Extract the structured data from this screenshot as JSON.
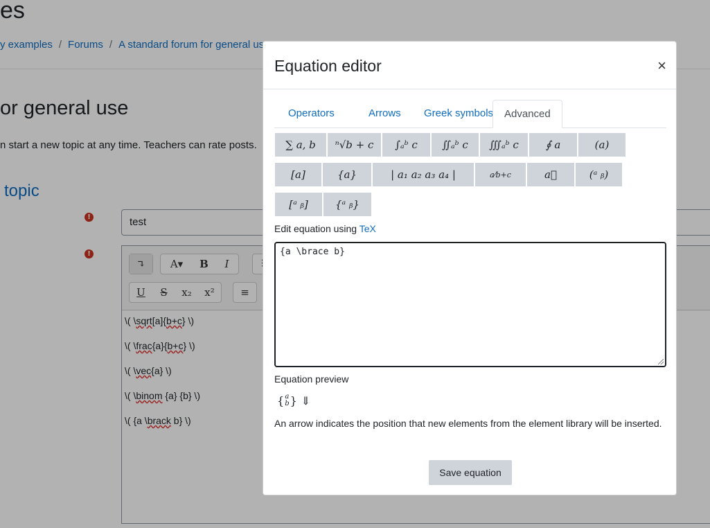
{
  "background": {
    "page_heading": "es",
    "breadcrumb": [
      "y examples",
      "Forums",
      "A standard forum for general use"
    ],
    "forum_title": "or general use",
    "forum_description": "n start a new topic at any time. Teachers can rate posts.",
    "section_title": "topic",
    "subject_value": "test",
    "editor_toolbar": {
      "row1": [
        "↴",
        "A▾",
        "B",
        "I",
        "⠿"
      ],
      "row2": [
        "U",
        "S",
        "x₂",
        "x²",
        "≡"
      ]
    },
    "editor_lines": [
      {
        "pre": "\\( \\",
        "sp": "sqrt",
        "mid": "[a]{",
        "sp2": "b+c",
        "post": "} \\)"
      },
      {
        "pre": "\\( \\",
        "sp": "frac",
        "mid": "{a}{",
        "sp2": "b+c",
        "post": "} \\)"
      },
      {
        "pre": "\\( \\",
        "sp": "vec",
        "mid": "{a} \\)",
        "sp2": "",
        "post": ""
      },
      {
        "pre": "\\( \\",
        "sp": "binom",
        "mid": " {a} {b} \\)",
        "sp2": "",
        "post": ""
      },
      {
        "pre": "\\( {a \\",
        "sp": "brack",
        "mid": " b} \\)",
        "sp2": "",
        "post": ""
      }
    ]
  },
  "modal": {
    "title": "Equation editor",
    "close_glyph": "×",
    "tabs": [
      "Operators",
      "Arrows",
      "Greek symbols",
      "Advanced"
    ],
    "active_tab": "Advanced",
    "library": {
      "row1": [
        "∑ a, b",
        "ⁿ√b + c",
        "∫ₐᵇ c",
        "∬ₐᵇ c",
        "∭ₐᵇ c",
        "∮ a",
        "(a)"
      ],
      "row2": [
        "[a]",
        "{a}",
        "| a₁  a₂ a₃  a₄ |",
        "a⁄b+c",
        "a⃗",
        "(ᵃ ᵦ)"
      ],
      "row3": [
        "[ᵃ ᵦ]",
        "{ᵃ ᵦ}"
      ]
    },
    "edit_label": "Edit equation using",
    "edit_link": "TeX",
    "tex_value": "{a \\brace b}",
    "preview_label": "Equation preview",
    "preview_top": "a",
    "preview_bottom": "b",
    "preview_arrow": "⇓",
    "note": "An arrow indicates the position that new elements from the element library will be inserted.",
    "save_label": "Save equation"
  }
}
